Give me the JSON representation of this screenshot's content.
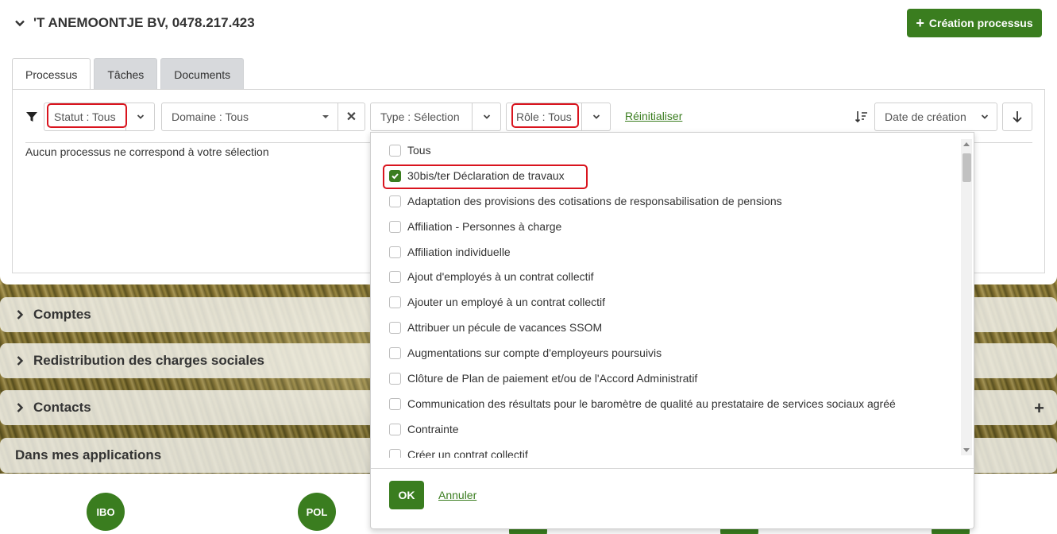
{
  "header": {
    "company": "'T ANEMOONTJE BV, 0478.217.423",
    "create_button": "Création processus"
  },
  "tabs": [
    {
      "label": "Processus",
      "active": true
    },
    {
      "label": "Tâches",
      "active": false
    },
    {
      "label": "Documents",
      "active": false
    }
  ],
  "filters": {
    "statut": "Statut : Tous",
    "domaine": "Domaine : Tous",
    "type": "Type : Sélection",
    "role": "Rôle : Tous",
    "reset": "Réinitialiser",
    "sort": "Date de création"
  },
  "empty_message": "Aucun processus ne correspond à votre sélection",
  "dropdown": {
    "options": [
      {
        "label": "Tous",
        "checked": false
      },
      {
        "label": "30bis/ter Déclaration de travaux",
        "checked": true
      },
      {
        "label": "Adaptation des provisions des cotisations de responsabilisation de pensions",
        "checked": false
      },
      {
        "label": "Affiliation - Personnes à charge",
        "checked": false
      },
      {
        "label": "Affiliation individuelle",
        "checked": false
      },
      {
        "label": "Ajout d'employés à un contrat collectif",
        "checked": false
      },
      {
        "label": "Ajouter un employé à un contrat collectif",
        "checked": false
      },
      {
        "label": "Attribuer un pécule de vacances SSOM",
        "checked": false
      },
      {
        "label": "Augmentations sur compte d'employeurs poursuivis",
        "checked": false
      },
      {
        "label": "Clôture de Plan de paiement et/ou de l'Accord Administratif",
        "checked": false
      },
      {
        "label": "Communication des résultats pour le baromètre de qualité au prestataire de services sociaux agréé",
        "checked": false
      },
      {
        "label": "Contrainte",
        "checked": false
      },
      {
        "label": "Créer un contrat collectif",
        "checked": false
      }
    ],
    "ok": "OK",
    "cancel": "Annuler"
  },
  "sections": {
    "comptes": "Comptes",
    "redistribution": "Redistribution des charges sociales",
    "contacts": "Contacts",
    "applications": "Dans mes applications"
  },
  "apps": [
    "IBO",
    "POL"
  ],
  "colors": {
    "accent": "#3a7d1f",
    "highlight": "#d9141e"
  }
}
